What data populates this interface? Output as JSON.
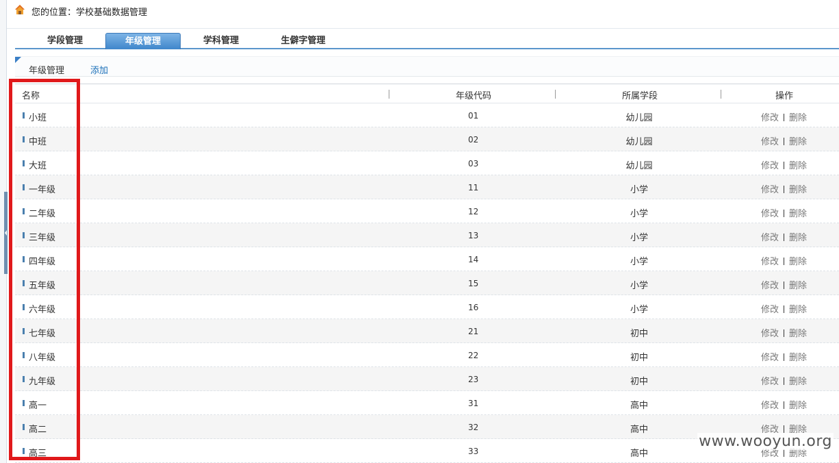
{
  "breadcrumb": "您的位置：学校基础数据管理",
  "tabs": [
    {
      "label": "学段管理",
      "active": false
    },
    {
      "label": "年级管理",
      "active": true
    },
    {
      "label": "学科管理",
      "active": false
    },
    {
      "label": "生僻字管理",
      "active": false
    }
  ],
  "subheader": {
    "title": "年级管理",
    "add_label": "添加"
  },
  "table": {
    "columns": [
      "名称",
      "年级代码",
      "所属学段",
      "操作"
    ],
    "rows": [
      {
        "name": "小班",
        "code": "01",
        "stage": "幼儿园"
      },
      {
        "name": "中班",
        "code": "02",
        "stage": "幼儿园"
      },
      {
        "name": "大班",
        "code": "03",
        "stage": "幼儿园"
      },
      {
        "name": "一年级",
        "code": "11",
        "stage": "小学"
      },
      {
        "name": "二年级",
        "code": "12",
        "stage": "小学"
      },
      {
        "name": "三年级",
        "code": "13",
        "stage": "小学"
      },
      {
        "name": "四年级",
        "code": "14",
        "stage": "小学"
      },
      {
        "name": "五年级",
        "code": "15",
        "stage": "小学"
      },
      {
        "name": "六年级",
        "code": "16",
        "stage": "小学"
      },
      {
        "name": "七年级",
        "code": "21",
        "stage": "初中"
      },
      {
        "name": "八年级",
        "code": "22",
        "stage": "初中"
      },
      {
        "name": "九年级",
        "code": "23",
        "stage": "初中"
      },
      {
        "name": "高一",
        "code": "31",
        "stage": "高中"
      },
      {
        "name": "高二",
        "code": "32",
        "stage": "高中"
      },
      {
        "name": "高三",
        "code": "33",
        "stage": "高中"
      }
    ],
    "edit_label": "修改",
    "delete_label": "删除"
  },
  "watermark": "www.wooyun.org",
  "colors": {
    "accent": "#3f86cb",
    "highlight": "#e0191b",
    "link": "#1a6fb8"
  },
  "icons": {
    "home": "home-icon"
  }
}
